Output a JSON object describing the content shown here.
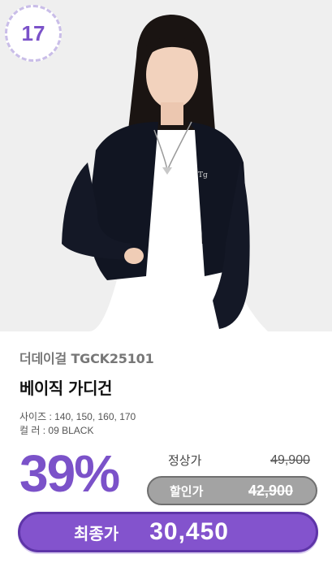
{
  "badge": {
    "rank": "17"
  },
  "product": {
    "brand_code": "더데이걸 TGCK25101",
    "name": "베이직 가디건",
    "specs": [
      "사이즈 : 140, 150, 160, 170",
      "컬    러 : 09 BLACK"
    ]
  },
  "pricing": {
    "discount": "39%",
    "regular_label": "정상가",
    "regular_price": "49,900",
    "sale_label": "할인가",
    "sale_price": "42,900",
    "final_label": "최종가",
    "final_price": "30,450"
  },
  "colors": {
    "accent": "#7b52c9",
    "final_bar": "#8353cd",
    "sale_pill": "#a3a3a3"
  }
}
